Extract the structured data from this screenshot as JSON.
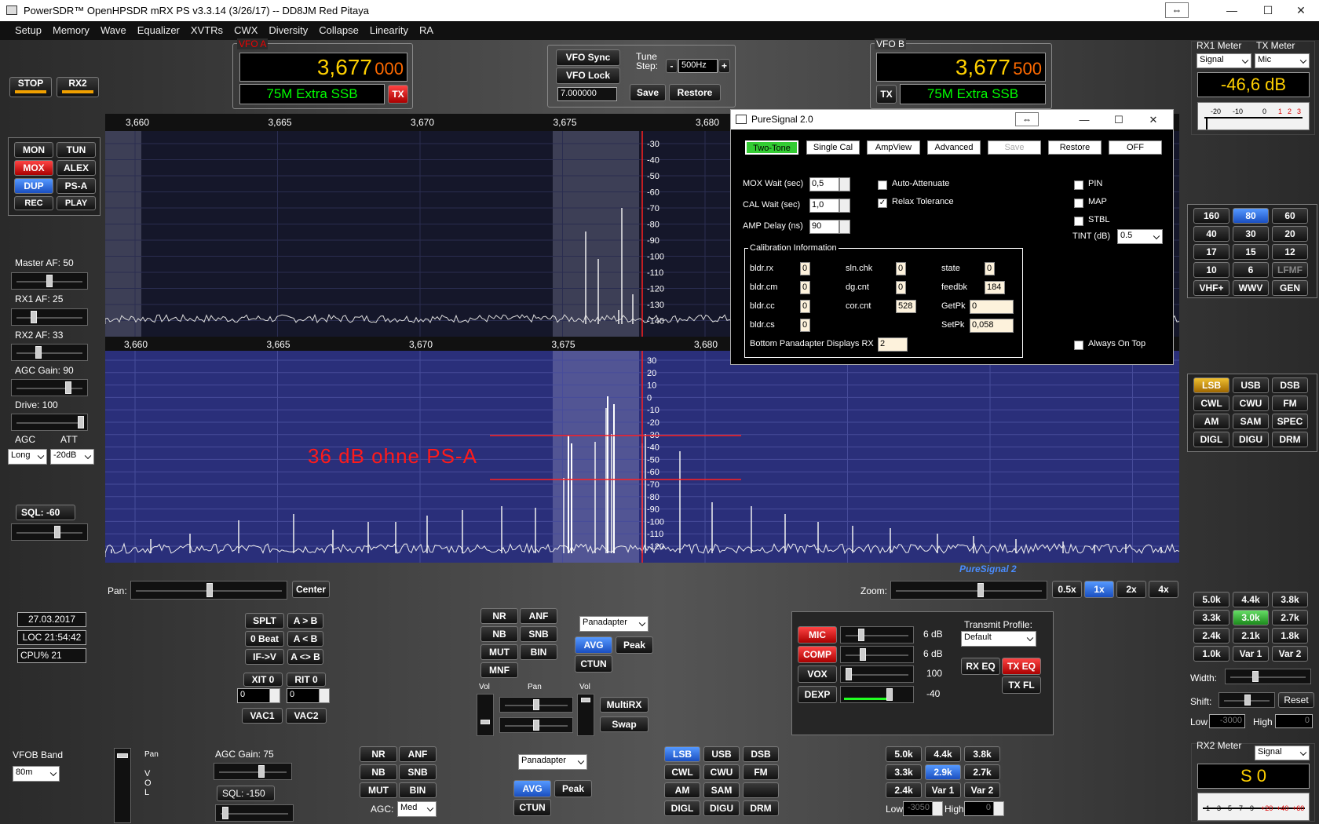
{
  "app": {
    "title": "PowerSDR™ OpenHPSDR mRX PS v3.3.14 (3/26/17)  --  DD8JM Red Pitaya"
  },
  "window_controls": {
    "resize": "⇔",
    "minimize": "—",
    "maximize": "☐",
    "close": "✕"
  },
  "menu": [
    "Setup",
    "Memory",
    "Wave",
    "Equalizer",
    "XVTRs",
    "CWX",
    "Diversity",
    "Collapse",
    "Linearity",
    "RA"
  ],
  "left": {
    "stop": "STOP",
    "rx2": "RX2",
    "mon": "MON",
    "tun": "TUN",
    "mox": "MOX",
    "alex": "ALEX",
    "dup": "DUP",
    "psa": "PS-A",
    "rec": "REC",
    "play": "PLAY",
    "master_af": "Master AF:  50",
    "rx1_af": "RX1 AF:  25",
    "rx2_af": "RX2 AF:  33",
    "agc_gain": "AGC Gain:  90",
    "drive": "Drive:  100",
    "agc": "AGC",
    "att": "ATT",
    "agc_val": "Long",
    "att_val": "-20dB",
    "sql": "SQL: -60"
  },
  "vfoa": {
    "label": "VFO A",
    "freq_main": "3,677",
    "freq_sub": "000",
    "band_label": "75M Extra SSB",
    "tx": "TX"
  },
  "vfob": {
    "label": "VFO B",
    "freq_main": "3,677",
    "freq_sub": "500",
    "band_label": "75M Extra SSB",
    "tx": "TX"
  },
  "vfocenter": {
    "sync": "VFO Sync",
    "lock": "VFO Lock",
    "tune_step_label": "Tune\nStep:",
    "tune_step": "500Hz",
    "minus": "-",
    "plus": "+",
    "freq": "7.000000",
    "save": "Save",
    "restore": "Restore"
  },
  "meters": {
    "rx1_label": "RX1 Meter",
    "tx_label": "TX Meter",
    "rx1_sel": "Signal",
    "tx_sel": "Mic",
    "value": "-46,6 dB",
    "scale": [
      "-20",
      "-10",
      "0",
      "1",
      "2",
      "3"
    ],
    "rx2_label": "RX2 Meter",
    "rx2_sel": "Signal",
    "rx2_value": "S 0",
    "rx2_scale": [
      "1",
      "3",
      "5",
      "7",
      "9",
      "+20",
      "+40",
      "+60"
    ]
  },
  "bands": [
    "160",
    "80",
    "60",
    "40",
    "30",
    "20",
    "17",
    "15",
    "12",
    "10",
    "6",
    "LFMF",
    "VHF+",
    "WWV",
    "GEN"
  ],
  "modes": [
    "LSB",
    "USB",
    "DSB",
    "CWL",
    "CWU",
    "FM",
    "AM",
    "SAM",
    "SPEC",
    "DIGL",
    "DIGU",
    "DRM"
  ],
  "filters": [
    "5.0k",
    "4.4k",
    "3.8k",
    "3.3k",
    "3.0k",
    "2.7k",
    "2.4k",
    "2.1k",
    "1.8k",
    "1.0k",
    "Var 1",
    "Var 2"
  ],
  "filter_ctl": {
    "width": "Width:",
    "shift": "Shift:",
    "reset": "Reset",
    "low": "Low",
    "low_val": "-3000",
    "high": "High",
    "high_val": "0"
  },
  "pan_top": {
    "freq_ticks": [
      "3,660",
      "3,665",
      "3,670",
      "3,675",
      "3,680"
    ],
    "db_ticks": [
      "-30",
      "-40",
      "-50",
      "-60",
      "-70",
      "-80",
      "-90",
      "-100",
      "-110",
      "-120",
      "-130",
      "-140"
    ]
  },
  "pan_bot": {
    "freq_ticks": [
      "3,660",
      "3,665",
      "3,670",
      "3,675",
      "3,680"
    ],
    "db_ticks": [
      "30",
      "20",
      "10",
      "0",
      "-10",
      "-20",
      "-30",
      "-40",
      "-50",
      "-60",
      "-70",
      "-80",
      "-90",
      "-100",
      "-110",
      "-120"
    ],
    "annotation": "36 dB ohne PS-A",
    "brand": "PureSignal 2"
  },
  "pan_ctl": {
    "pan": "Pan:",
    "center": "Center",
    "zoom": "Zoom:",
    "z05": "0.5x",
    "z1": "1x",
    "z2": "2x",
    "z4": "4x"
  },
  "status": {
    "date": "27.03.2017",
    "loc": "LOC 21:54:42",
    "cpu": "CPU%  21"
  },
  "vfo_ops": {
    "splt": "SPLT",
    "atob": "A > B",
    "beat": "0 Beat",
    "btoa": "A < B",
    "ifv": "IF->V",
    "swapab": "A <> B",
    "xit": "XIT",
    "xit_val": "0",
    "rit": "RIT",
    "rit_val": "0",
    "xit_field": "0",
    "rit_field": "0",
    "vac1": "VAC1",
    "vac2": "VAC2"
  },
  "dsp": {
    "nr": "NR",
    "anf": "ANF",
    "nb": "NB",
    "snb": "SNB",
    "mut": "MUT",
    "bin": "BIN",
    "mnf": "MNF",
    "display": "Panadapter",
    "avg": "AVG",
    "peak": "Peak",
    "ctun": "CTUN",
    "vol": "Vol",
    "pan": "Pan",
    "vol2": "Vol",
    "multirx": "MultiRX",
    "swap": "Swap"
  },
  "tx": {
    "mic": "MIC",
    "mic_val": "6 dB",
    "comp": "COMP",
    "comp_val": "6 dB",
    "vox": "VOX",
    "vox_val": "100",
    "dexp": "DEXP",
    "dexp_val": "-40",
    "profile_label": "Transmit Profile:",
    "profile": "Default",
    "rxeq": "RX EQ",
    "txeq": "TX EQ",
    "txfl": "TX FL"
  },
  "rx2": {
    "vfob_band": "VFOB Band",
    "band": "80m",
    "pan": "Pan",
    "vol": "V\nO\nL",
    "agc_gain": "AGC Gain:  75",
    "sql": "SQL:  -150",
    "nr": "NR",
    "anf": "ANF",
    "nb": "NB",
    "snb": "SNB",
    "mut": "MUT",
    "bin": "BIN",
    "agc": "AGC:",
    "agc_val": "Med",
    "display": "Panadapter",
    "avg": "AVG",
    "peak": "Peak",
    "ctun": "CTUN",
    "modes": [
      "LSB",
      "USB",
      "DSB",
      "CWL",
      "CWU",
      "FM",
      "AM",
      "SAM",
      "",
      "DIGL",
      "DIGU",
      "DRM"
    ],
    "filters": [
      "5.0k",
      "4.4k",
      "3.8k",
      "3.3k",
      "2.9k",
      "2.7k",
      "2.4k",
      "Var 1",
      "Var 2"
    ],
    "low": "Low",
    "low_val": "-3050",
    "high": "High",
    "high_val": "0"
  },
  "ps": {
    "title": "PureSignal 2.0",
    "tabs": [
      "Two-Tone",
      "Single Cal",
      "AmpView",
      "Advanced",
      "Save",
      "Restore",
      "OFF"
    ],
    "mox_wait": "MOX Wait (sec)",
    "mox_val": "0,5",
    "cal_wait": "CAL Wait (sec)",
    "cal_val": "1,0",
    "amp_delay": "AMP Delay (ns)",
    "amp_val": "90",
    "auto_att": "Auto-Attenuate",
    "relax": "Relax Tolerance",
    "pin": "PIN",
    "map": "MAP",
    "stbl": "STBL",
    "tint": "TINT (dB)",
    "tint_val": "0.5",
    "cal_info": "Calibration Information",
    "bldr_rx": "bldr.rx",
    "bldr_rx_v": "0",
    "bldr_cm": "bldr.cm",
    "bldr_cm_v": "0",
    "bldr_cc": "bldr.cc",
    "bldr_cc_v": "0",
    "bldr_cs": "bldr.cs",
    "bldr_cs_v": "0",
    "sln_chk": "sln.chk",
    "sln_chk_v": "0",
    "dg_cnt": "dg.cnt",
    "dg_cnt_v": "0",
    "cor_cnt": "cor.cnt",
    "cor_cnt_v": "528",
    "state": "state",
    "state_v": "0",
    "feedbk": "feedbk",
    "feedbk_v": "184",
    "getpk": "GetPk",
    "getpk_v": "0",
    "setpk": "SetPk",
    "setpk_v": "0,058",
    "bottom": "Bottom Panadapter Displays RX",
    "bottom_v": "2",
    "always": "Always On Top"
  },
  "colors": {
    "vfo_freq": "#ffd000",
    "vfo_green": "#00ff00",
    "annotation": "#ff1a1a",
    "pan_bg": "#2a2f7a",
    "accent_blue": "#1a4fc0"
  }
}
